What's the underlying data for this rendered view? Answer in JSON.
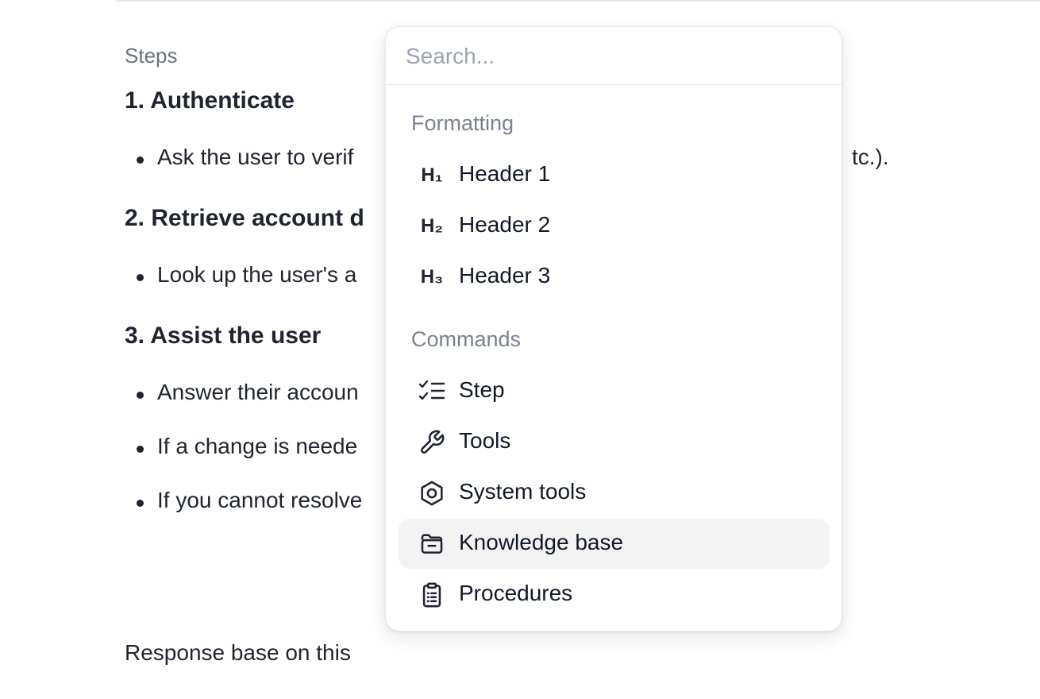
{
  "editor": {
    "steps_label": "Steps",
    "sections": [
      {
        "heading": "1. Authenticate",
        "bullets": [
          "Ask the user to verif"
        ]
      },
      {
        "heading": "2. Retrieve account d",
        "bullets": [
          "Look up the user's a"
        ]
      },
      {
        "heading": "3. Assist the user",
        "bullets": [
          "Answer their accoun",
          "If a change is neede",
          "If you cannot resolve"
        ]
      }
    ],
    "bullet1_tail": "tc.).",
    "response_text": "Response base on this"
  },
  "menu": {
    "search_placeholder": "Search...",
    "formatting_label": "Formatting",
    "formatting_items": [
      {
        "icon": "heading-1-icon",
        "glyph": "H₁",
        "label": "Header 1"
      },
      {
        "icon": "heading-2-icon",
        "glyph": "H₂",
        "label": "Header 2"
      },
      {
        "icon": "heading-3-icon",
        "glyph": "H₃",
        "label": "Header 3"
      }
    ],
    "commands_label": "Commands",
    "command_items": [
      {
        "icon": "checklist-icon",
        "label": "Step"
      },
      {
        "icon": "wrench-icon",
        "label": "Tools"
      },
      {
        "icon": "hexagon-nut-icon",
        "label": "System tools"
      },
      {
        "icon": "folder-icon",
        "label": "Knowledge base",
        "active": true
      },
      {
        "icon": "clipboard-list-icon",
        "label": "Procedures"
      }
    ]
  }
}
